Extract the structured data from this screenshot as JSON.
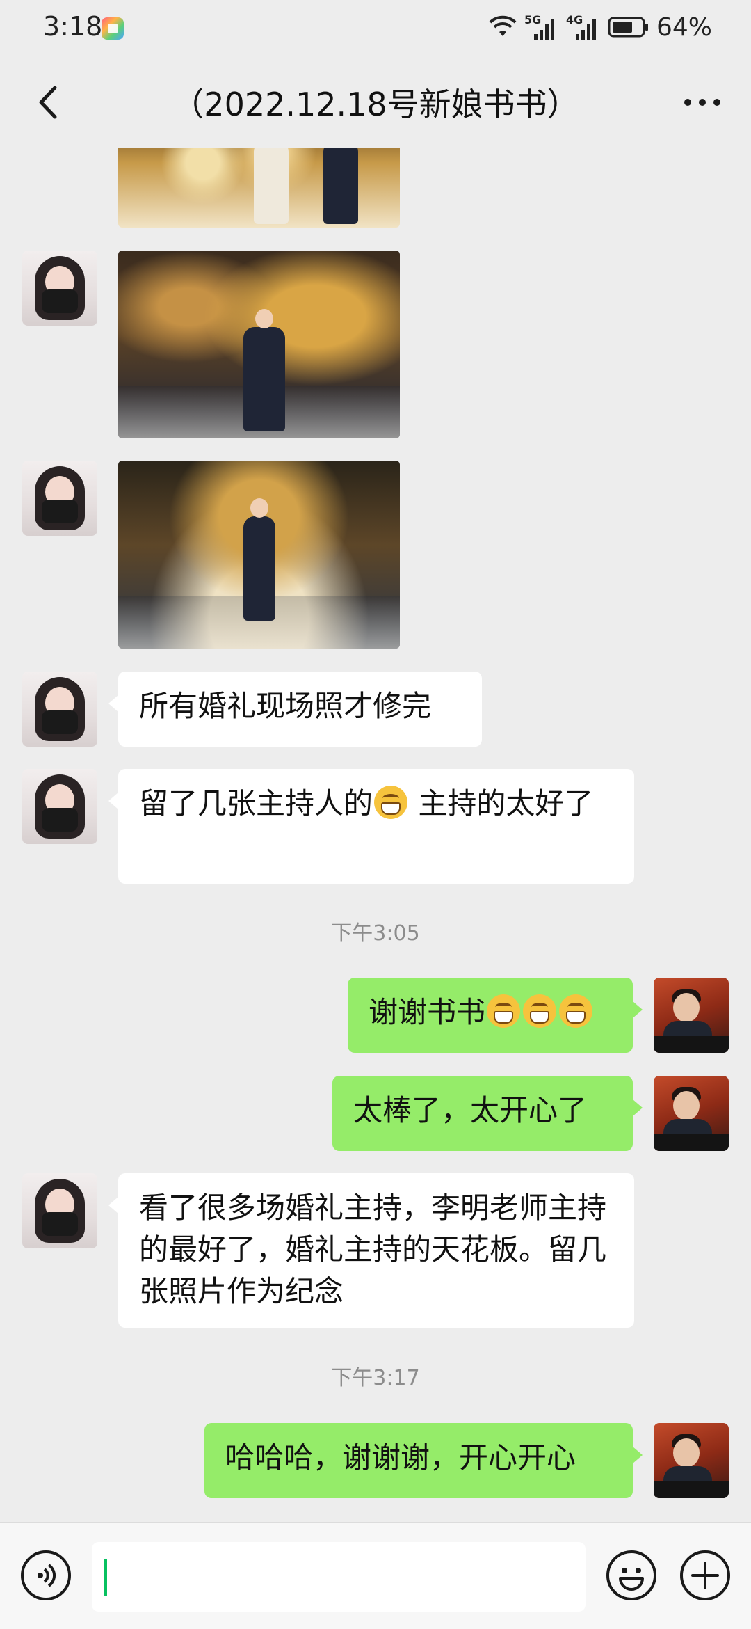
{
  "status_bar": {
    "time": "3:18",
    "network_1": "5G",
    "network_2": "4G",
    "battery": "64%"
  },
  "header": {
    "title": "（2022.12.18号新娘书书）"
  },
  "messages": [
    {
      "type": "image",
      "side": "in",
      "icon": "wedding-photo"
    },
    {
      "type": "image",
      "side": "in",
      "icon": "wedding-photo"
    },
    {
      "type": "image",
      "side": "in",
      "icon": "wedding-photo"
    },
    {
      "type": "text",
      "side": "in",
      "text": "所有婚礼现场照才修完"
    },
    {
      "type": "text",
      "side": "in",
      "text_a": "留了几张主持人的",
      "emoji": "grin-emoji",
      "text_b": " 主持的太好了"
    },
    {
      "type": "timestamp",
      "text": "下午3:05"
    },
    {
      "type": "text",
      "side": "out",
      "text": "谢谢书书",
      "emoji": "grin-emoji",
      "emoji_count": 3
    },
    {
      "type": "text",
      "side": "out",
      "text": "太棒了，太开心了"
    },
    {
      "type": "text",
      "side": "in",
      "text": "看了很多场婚礼主持，李明老师主持的最好了，婚礼主持的天花板。留几张照片作为纪念"
    },
    {
      "type": "timestamp",
      "text": "下午3:17"
    },
    {
      "type": "text",
      "side": "out",
      "text": "哈哈哈，谢谢谢，开心开心"
    }
  ],
  "input_bar": {
    "value": "",
    "icons": [
      "voice-icon",
      "emoji-icon",
      "plus-icon"
    ]
  },
  "colors": {
    "background": "#ededed",
    "outgoing_bubble": "#95ec69",
    "incoming_bubble": "#ffffff",
    "cursor": "#07c160"
  }
}
